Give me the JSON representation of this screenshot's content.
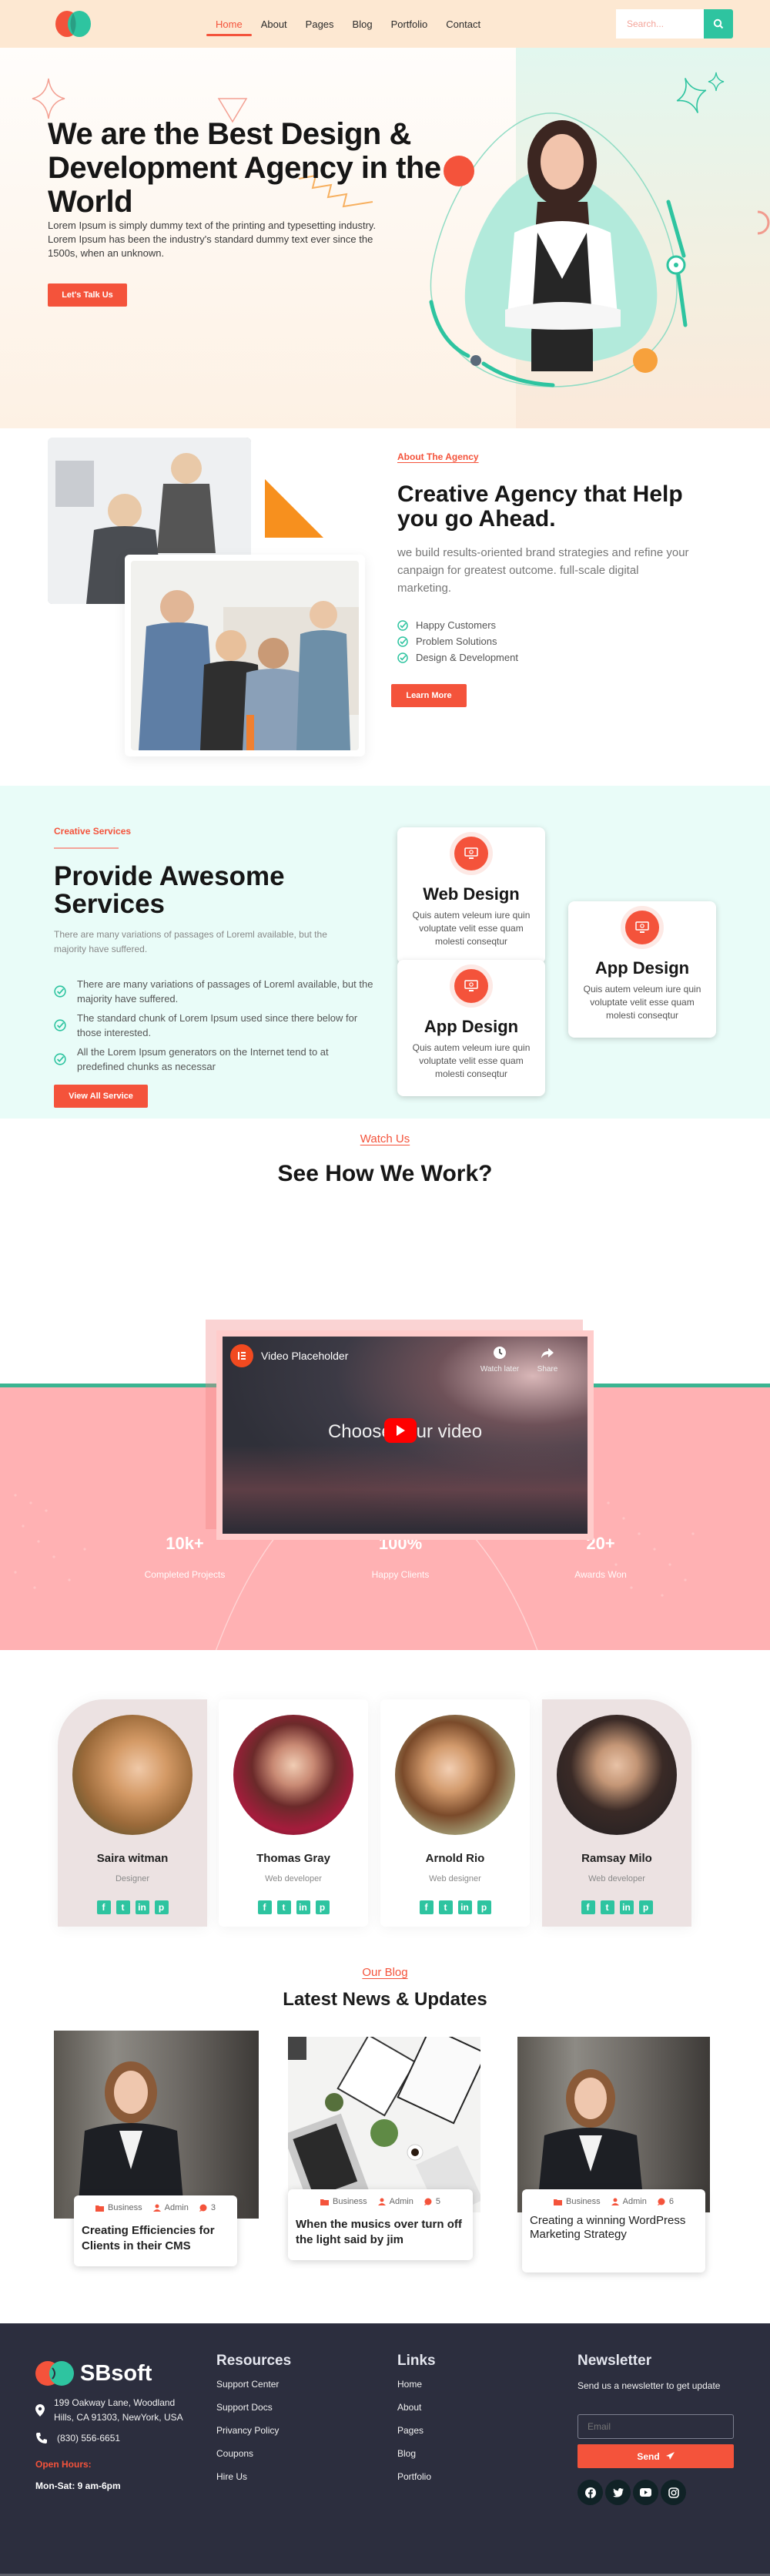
{
  "brand": {
    "name": "SBsoft",
    "colors": {
      "accent": "#f4533b",
      "teal": "#2ec4a0",
      "pink": "#ffb1b3",
      "footer": "#2c2e3e"
    }
  },
  "header": {
    "nav": [
      {
        "label": "Home",
        "active": true
      },
      {
        "label": "About",
        "active": false
      },
      {
        "label": "Pages",
        "active": false
      },
      {
        "label": "Blog",
        "active": false
      },
      {
        "label": "Portfolio",
        "active": false
      },
      {
        "label": "Contact",
        "active": false
      }
    ],
    "search": {
      "placeholder": "Search...",
      "icon": "search-icon"
    }
  },
  "hero": {
    "title": "We are the Best Design & Development Agency in the World",
    "text": "Lorem Ipsum is simply dummy text of the printing and typesetting industry. Lorem Ipsum has been the industry's standard dummy text ever since the 1500s, when an unknown.",
    "cta": "Let's Talk Us"
  },
  "about": {
    "kicker": "About The Agency",
    "title": "Creative Agency that Help you go Ahead.",
    "text": "we build results-oriented brand strategies and refine your canpaign for greatest outcome. full-scale digital marketing.",
    "checks": [
      "Happy Customers",
      "Problem Solutions",
      "Design & Development"
    ],
    "cta": "Learn More"
  },
  "services": {
    "kicker": "Creative Services",
    "title": "Provide Awesome Services",
    "text": "There are many variations of passages of Loreml available, but the majority have suffered.",
    "list": [
      "There are many variations of passages of Loreml available, but the majority have suffered.",
      "The standard chunk of Lorem Ipsum used since there below for those interested.",
      "All the Lorem Ipsum generators on the Internet tend to at predefined chunks as necessar"
    ],
    "cta": "View All Service",
    "cards": [
      {
        "title": "Web Design",
        "desc": "Quis autem veleum iure quin voluptate velit esse quam molesti conseqtur",
        "icon": "monitor-icon"
      },
      {
        "title": "App Design",
        "desc": "Quis autem veleum iure quin voluptate velit esse quam molesti conseqtur",
        "icon": "monitor-icon"
      },
      {
        "title": "App Design",
        "desc": "Quis autem veleum iure quin voluptate velit esse quam molesti conseqtur",
        "icon": "monitor-icon"
      }
    ]
  },
  "video": {
    "kicker": "Watch Us",
    "title": "See How We Work?",
    "player": {
      "channel": "Video Placeholder",
      "watch_later": "Watch later",
      "share": "Share",
      "center_text": "Choose your video"
    }
  },
  "stats": [
    {
      "value": "10k+",
      "label": "Completed Projects"
    },
    {
      "value": "100%",
      "label": "Happy Clients"
    },
    {
      "value": "20+",
      "label": "Awards Won"
    }
  ],
  "team": [
    {
      "name": "Saira witman",
      "role": "Designer"
    },
    {
      "name": "Thomas Gray",
      "role": "Web developer"
    },
    {
      "name": "Arnold Rio",
      "role": "Web designer"
    },
    {
      "name": "Ramsay Milo",
      "role": "Web developer"
    }
  ],
  "blog": {
    "kicker": "Our Blog",
    "title": "Latest News & Updates",
    "posts": [
      {
        "category": "Business",
        "author": "Admin",
        "comments": "3",
        "title": "Creating Efficiencies for Clients in their CMS"
      },
      {
        "category": "Business",
        "author": "Admin",
        "comments": "5",
        "title": "When the musics over turn off the light said by jim"
      },
      {
        "category": "Business",
        "author": "Admin",
        "comments": "6",
        "title": "Creating a winning WordPress Marketing Strategy"
      }
    ]
  },
  "footer": {
    "address": "199 Oakway Lane, Woodland Hills, CA 91303, NewYork, USA",
    "phone": "(830) 556-6651",
    "hours_label": "Open Hours:",
    "hours": "Mon-Sat: 9 am-6pm",
    "resources": {
      "title": "Resources",
      "items": [
        "Support Center",
        "Support Docs",
        "Privancy Policy",
        "Coupons",
        "Hire Us"
      ]
    },
    "links": {
      "title": "Links",
      "items": [
        "Home",
        "About",
        "Pages",
        "Blog",
        "Portfolio"
      ]
    },
    "newsletter": {
      "title": "Newsletter",
      "text": "Send us a newsletter to get update",
      "placeholder": "Email",
      "button": "Send"
    },
    "social": [
      "facebook-icon",
      "twitter-icon",
      "youtube-icon",
      "instagram-icon"
    ]
  }
}
